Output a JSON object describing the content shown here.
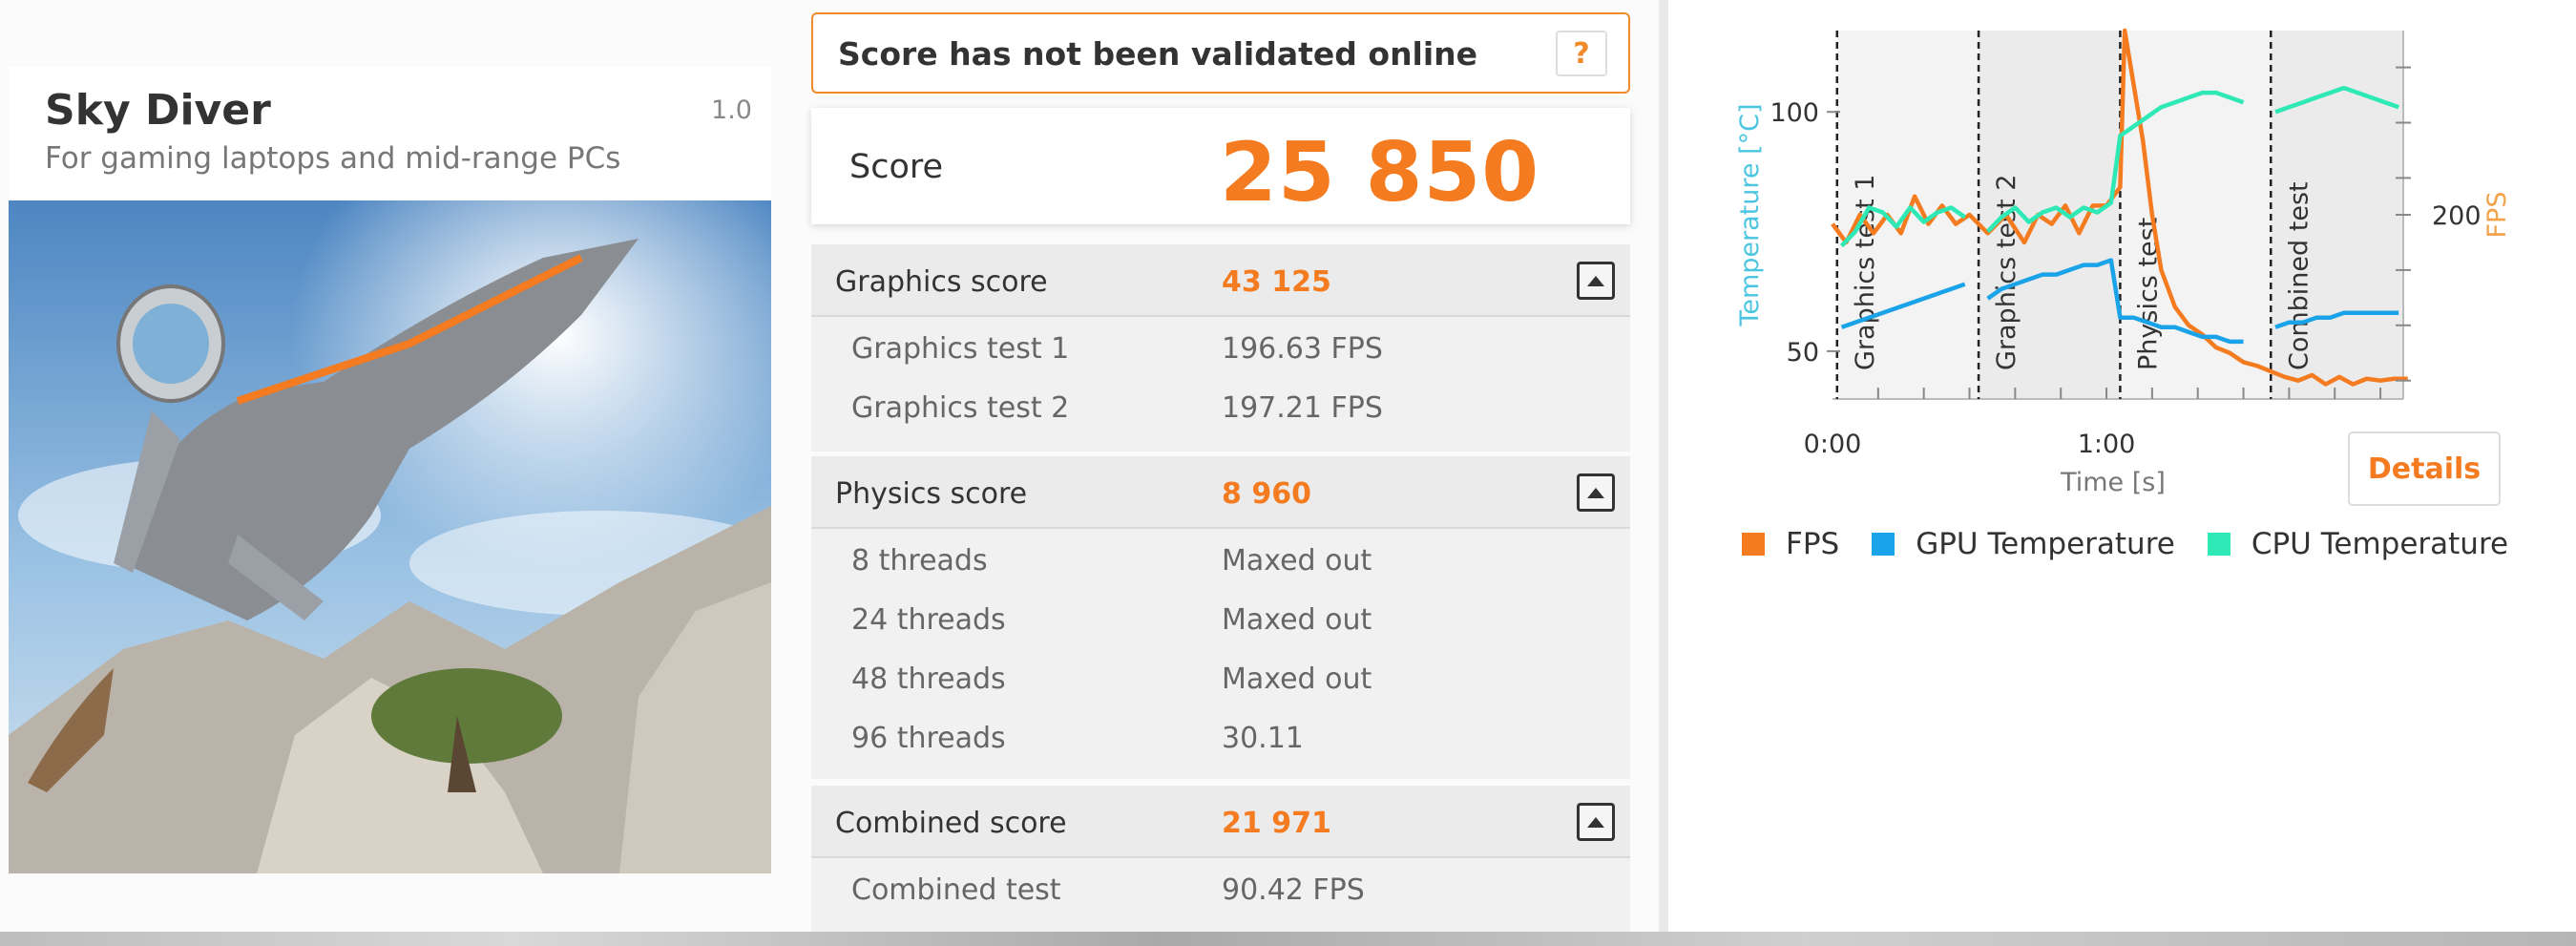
{
  "test": {
    "name": "Sky Diver",
    "version": "1.0",
    "description": "For gaming laptops and mid-range PCs"
  },
  "validation": {
    "message": "Score has not been validated online",
    "help_label": "?"
  },
  "score": {
    "label": "Score",
    "value": "25 850"
  },
  "graphics": {
    "title": "Graphics score",
    "value": "43 125",
    "rows": [
      {
        "label": "Graphics test 1",
        "value": "196.63  FPS"
      },
      {
        "label": "Graphics test 2",
        "value": "197.21  FPS"
      }
    ]
  },
  "physics": {
    "title": "Physics score",
    "value": "8 960",
    "rows": [
      {
        "label": "8 threads",
        "value": "Maxed out"
      },
      {
        "label": "24 threads",
        "value": "Maxed out"
      },
      {
        "label": "48 threads",
        "value": "Maxed out"
      },
      {
        "label": "96 threads",
        "value": "30.11"
      }
    ]
  },
  "combined": {
    "title": "Combined score",
    "value": "21 971",
    "rows": [
      {
        "label": "Combined test",
        "value": "90.42  FPS"
      }
    ]
  },
  "chart": {
    "details_label": "Details",
    "y_left_label": "Temperature [°C]",
    "y_right_label": "FPS",
    "x_label": "Time [s]",
    "x_ticks": [
      "0:00",
      "1:00"
    ],
    "y_left_ticks": [
      "100",
      "50"
    ],
    "y_right_ticks": [
      "200"
    ],
    "phases": [
      "Graphics test 1",
      "Graphics test 2",
      "Physics test",
      "Combined test"
    ],
    "legend": [
      {
        "label": "FPS",
        "color": "#f47b20"
      },
      {
        "label": "GPU Temperature",
        "color": "#1aa3e8"
      },
      {
        "label": "CPU Temperature",
        "color": "#2ee8b6"
      }
    ],
    "colors": {
      "fps": "#f47b20",
      "gpu": "#1aa3e8",
      "cpu": "#2ee8b6",
      "axis_left": "#4cc6e0",
      "axis_right": "#f4a24a"
    }
  },
  "chart_data": {
    "type": "line",
    "x_unit": "mm:ss",
    "xlim": [
      "0:00",
      "2:05"
    ],
    "ylim_left": [
      40,
      117
    ],
    "ylim_right": [
      100,
      300
    ],
    "series": [
      {
        "name": "FPS",
        "axis": "right",
        "x": [
          0,
          3,
          6,
          9,
          12,
          15,
          18,
          21,
          24,
          27,
          30,
          34,
          38,
          42,
          45,
          48,
          51,
          54,
          57,
          60,
          63,
          64,
          66,
          68,
          70,
          72,
          75,
          78,
          81,
          84,
          87,
          90,
          93,
          96,
          99,
          102,
          105,
          108,
          111,
          114,
          117,
          120,
          123,
          126
        ],
        "y": [
          195,
          185,
          200,
          190,
          200,
          190,
          210,
          195,
          205,
          195,
          200,
          190,
          200,
          185,
          200,
          195,
          205,
          190,
          205,
          205,
          215,
          300,
          270,
          240,
          200,
          170,
          150,
          140,
          135,
          128,
          125,
          120,
          118,
          115,
          112,
          110,
          113,
          108,
          112,
          108,
          111,
          110,
          111,
          111
        ]
      },
      {
        "name": "GPU Temperature",
        "x": [
          2,
          5,
          8,
          11,
          14,
          17,
          20,
          23,
          26,
          29,
          34,
          37,
          40,
          43,
          46,
          49,
          52,
          55,
          58,
          61,
          63,
          66,
          69,
          72,
          75,
          78,
          81,
          84,
          87,
          90,
          97,
          100,
          103,
          106,
          109,
          112,
          115,
          118,
          121,
          124
        ],
        "y": [
          55,
          56,
          57,
          58,
          59,
          60,
          61,
          62,
          63,
          64,
          61,
          63,
          64,
          65,
          66,
          66,
          67,
          68,
          68,
          69,
          57,
          57,
          56,
          55,
          55,
          54,
          53,
          53,
          52,
          52,
          55,
          56,
          56,
          57,
          57,
          58,
          58,
          58,
          58,
          58
        ]
      },
      {
        "name": "CPU Temperature",
        "x": [
          2,
          5,
          8,
          11,
          14,
          17,
          20,
          23,
          26,
          29,
          34,
          37,
          40,
          43,
          46,
          49,
          52,
          55,
          58,
          61,
          63,
          66,
          69,
          72,
          75,
          78,
          81,
          84,
          87,
          90,
          97,
          100,
          103,
          106,
          109,
          112,
          115,
          118,
          121,
          124
        ],
        "y": [
          72,
          75,
          80,
          79,
          76,
          80,
          77,
          79,
          80,
          78,
          75,
          78,
          80,
          77,
          79,
          80,
          78,
          80,
          79,
          81,
          95,
          97,
          99,
          101,
          102,
          103,
          104,
          104,
          103,
          102,
          100,
          101,
          102,
          103,
          104,
          105,
          104,
          103,
          102,
          101
        ]
      }
    ]
  }
}
